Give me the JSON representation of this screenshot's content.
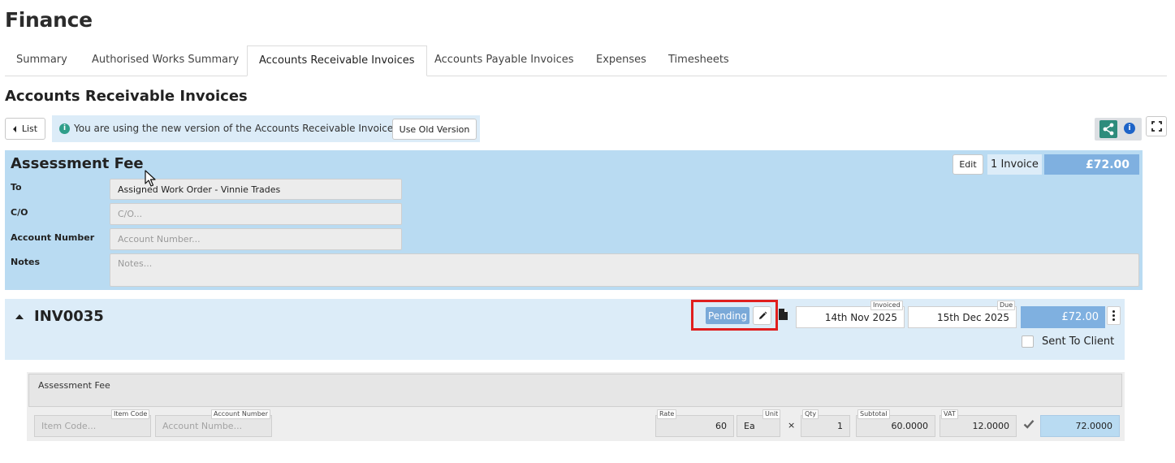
{
  "page": {
    "title": "Finance"
  },
  "tabs": [
    {
      "label": "Summary"
    },
    {
      "label": "Authorised Works Summary"
    },
    {
      "label": "Accounts Receivable Invoices",
      "active": true
    },
    {
      "label": "Accounts Payable Invoices"
    },
    {
      "label": "Expenses"
    },
    {
      "label": "Timesheets"
    }
  ],
  "section": {
    "title": "Accounts Receivable Invoices"
  },
  "toolbar": {
    "list_label": "List",
    "notice_text": "You are using the new version of the Accounts Receivable Invoices",
    "old_version_label": "Use Old Version",
    "icons": [
      "caret-left-icon",
      "info-icon",
      "share-icon",
      "info-icon",
      "expand-icon"
    ]
  },
  "group": {
    "title": "Assessment Fee",
    "edit_label": "Edit",
    "invoice_count": "1 Invoice",
    "total": "£72.00",
    "fields": {
      "to_label": "To",
      "to_value": "Assigned Work Order - Vinnie Trades",
      "co_label": "C/O",
      "co_placeholder": "C/O...",
      "account_label": "Account Number",
      "account_placeholder": "Account Number...",
      "notes_label": "Notes",
      "notes_placeholder": "Notes..."
    }
  },
  "invoice": {
    "number": "INV0035",
    "status": "Pending",
    "invoiced_label": "Invoiced",
    "invoiced_date": "14th Nov 2025",
    "due_label": "Due",
    "due_date": "15th Dec 2025",
    "total": "£72.00",
    "sent_to_client_label": "Sent To Client",
    "sent_to_client": false,
    "icons": [
      "caret-up-icon",
      "pencil-icon",
      "document-icon",
      "more-vertical-icon"
    ]
  },
  "line_item": {
    "description": "Assessment Fee",
    "item_code_label": "Item Code",
    "item_code_placeholder": "Item Code...",
    "account_number_label": "Account Number",
    "account_number_placeholder": "Account Numbe...",
    "rate_label": "Rate",
    "rate": "60",
    "unit_label": "Unit",
    "unit": "Ea",
    "times": "×",
    "qty_label": "Qty",
    "qty": "1",
    "subtotal_label": "Subtotal",
    "subtotal": "60.0000",
    "vat_label": "VAT",
    "vat": "12.0000",
    "vat_included": true,
    "total": "72.0000"
  },
  "colors": {
    "panel_bg": "#b9dbf2",
    "invoice_bg": "#dcecf8",
    "total_badge": "#7fb0e0",
    "highlight": "#e01e1e",
    "share_green": "#2e8c7c",
    "info_blue": "#1e64c8"
  }
}
